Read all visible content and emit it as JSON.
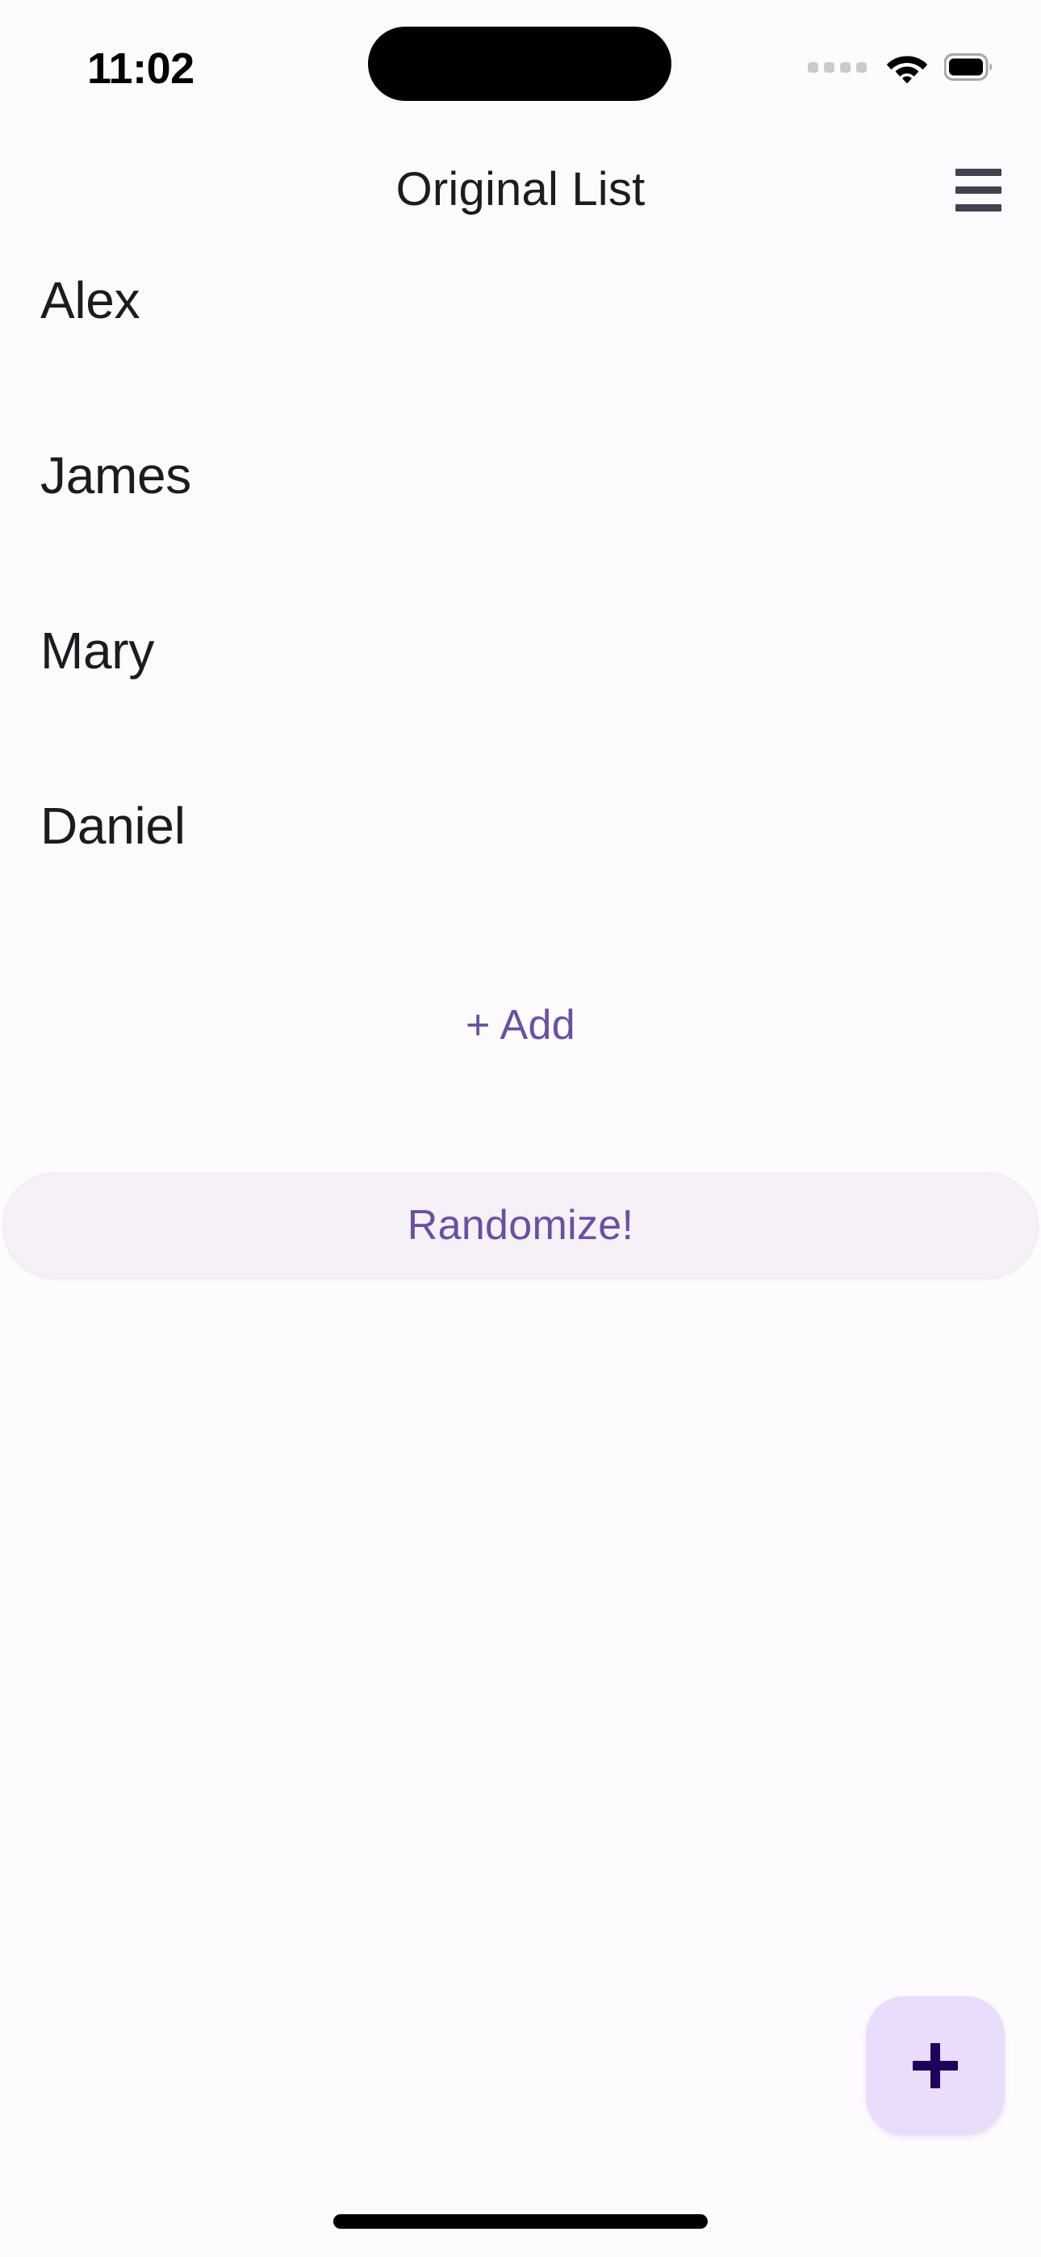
{
  "colors": {
    "background": "#FEFBFF",
    "primary": "#6750A4",
    "on_surface": "#1C1B1F",
    "fab_container": "#E9DDFB",
    "fab_icon": "#21005D",
    "button_surface": "#F5F1F7",
    "menu_icon": "#454050"
  },
  "status_bar": {
    "time": "11:02",
    "signal_icon": "signal-dots-icon",
    "wifi_icon": "wifi-icon",
    "battery_icon": "battery-full-icon",
    "dynamic_island": "dynamic-island"
  },
  "app_bar": {
    "title": "Original List",
    "menu_icon": "hamburger-menu-icon"
  },
  "list": {
    "items": [
      {
        "label": "Alex"
      },
      {
        "label": "James"
      },
      {
        "label": "Mary"
      },
      {
        "label": "Daniel"
      }
    ]
  },
  "add_button": {
    "label": "+ Add"
  },
  "randomize_button": {
    "label": "Randomize!"
  },
  "fab": {
    "icon": "plus-icon"
  },
  "home_indicator": {
    "name": "home-indicator"
  }
}
